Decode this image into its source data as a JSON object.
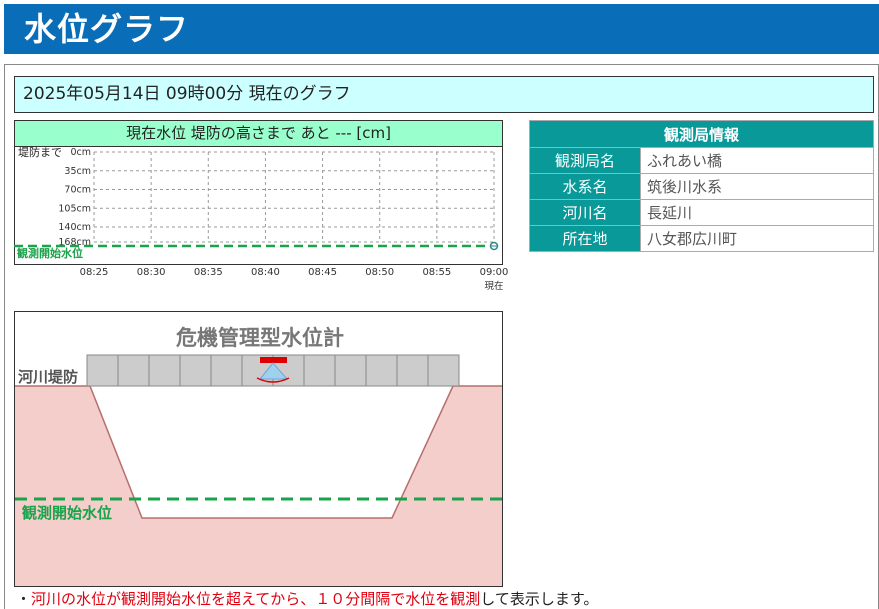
{
  "header": {
    "title": "水位グラフ"
  },
  "date_bar": {
    "text": "2025年05月14日 09時00分 現在のグラフ"
  },
  "graph": {
    "title": "現在水位 堤防の高さまで あと --- [cm]",
    "y_top_label": "堤防まで",
    "y_ticks": [
      "0cm",
      "35cm",
      "70cm",
      "105cm",
      "140cm",
      "168cm"
    ],
    "x_ticks": [
      "08:25",
      "08:30",
      "08:35",
      "08:40",
      "08:45",
      "08:50",
      "08:55",
      "09:00"
    ],
    "x_last_sub": "現在",
    "threshold_label": "観測開始水位",
    "threshold_color": "#1aa34a"
  },
  "chart_data": {
    "type": "line",
    "title": "現在水位 堤防の高さまで あと --- [cm]",
    "xlabel": "",
    "ylabel": "堤防まで",
    "x": [
      "08:25",
      "08:30",
      "08:35",
      "08:40",
      "08:45",
      "08:50",
      "08:55",
      "09:00"
    ],
    "ylim": [
      0,
      168
    ],
    "y_inverted": true,
    "grid": true,
    "series": [
      {
        "name": "観測開始水位",
        "values": [
          168,
          168,
          168,
          168,
          168,
          168,
          168,
          168
        ]
      }
    ],
    "current_marker": {
      "x": "09:00",
      "y": 168
    }
  },
  "station": {
    "title": "観測局情報",
    "rows": [
      {
        "label": "観測局名",
        "value": "ふれあい橋"
      },
      {
        "label": "水系名",
        "value": "筑後川水系"
      },
      {
        "label": "河川名",
        "value": "長延川"
      },
      {
        "label": "所在地",
        "value": "八女郡広川町"
      }
    ]
  },
  "diagram": {
    "title": "危機管理型水位計",
    "levee_label": "河川堤防",
    "threshold_label": "観測開始水位",
    "colors": {
      "ground": "#f3ceca",
      "levee": "#cccccc",
      "threshold": "#1aa34a",
      "sensor": "#dd0000"
    }
  },
  "note": {
    "bullet": "・",
    "red_part": "河川の水位が観測開始水位を超えてから、１０分間隔で水位を観測",
    "black_part": "して表示します。"
  }
}
